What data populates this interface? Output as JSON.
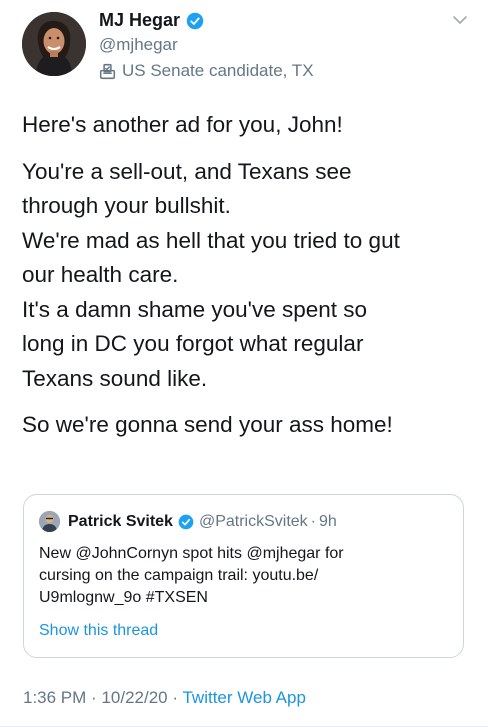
{
  "author": {
    "display_name": "MJ Hegar",
    "handle": "@mjhegar",
    "label": "US Senate candidate, TX",
    "label_icon": "ballot-box-icon",
    "verified_icon": "verified-badge-icon"
  },
  "tweet": {
    "paragraph1": "Here's another ad for you, John!",
    "paragraph2_lines": [
      "You're a sell-out, and Texans see",
      "through your bullshit.",
      "We're mad as hell that you tried to gut",
      "our health care.",
      "It's a damn shame you've spent so",
      "long in DC you forgot what regular",
      "Texans sound like."
    ],
    "paragraph3": "So we're gonna send your ass home!"
  },
  "quoted_tweet": {
    "display_name": "Patrick Svitek",
    "handle": "@PatrickSvitek",
    "separator": "·",
    "time": "9h",
    "text_lines": [
      "New @JohnCornyn spot hits @mjhegar for",
      "cursing on the campaign trail: youtu.be/",
      "U9mlognw_9o #TXSEN"
    ],
    "show_thread": "Show this thread"
  },
  "meta": {
    "time": "1:36 PM",
    "separator": "·",
    "date": "10/22/20",
    "app": "Twitter Web App"
  },
  "colors": {
    "accent": "#1b95e0",
    "secondary_text": "#657786",
    "border": "#ccd6dd",
    "verified": "#1da1f2"
  }
}
